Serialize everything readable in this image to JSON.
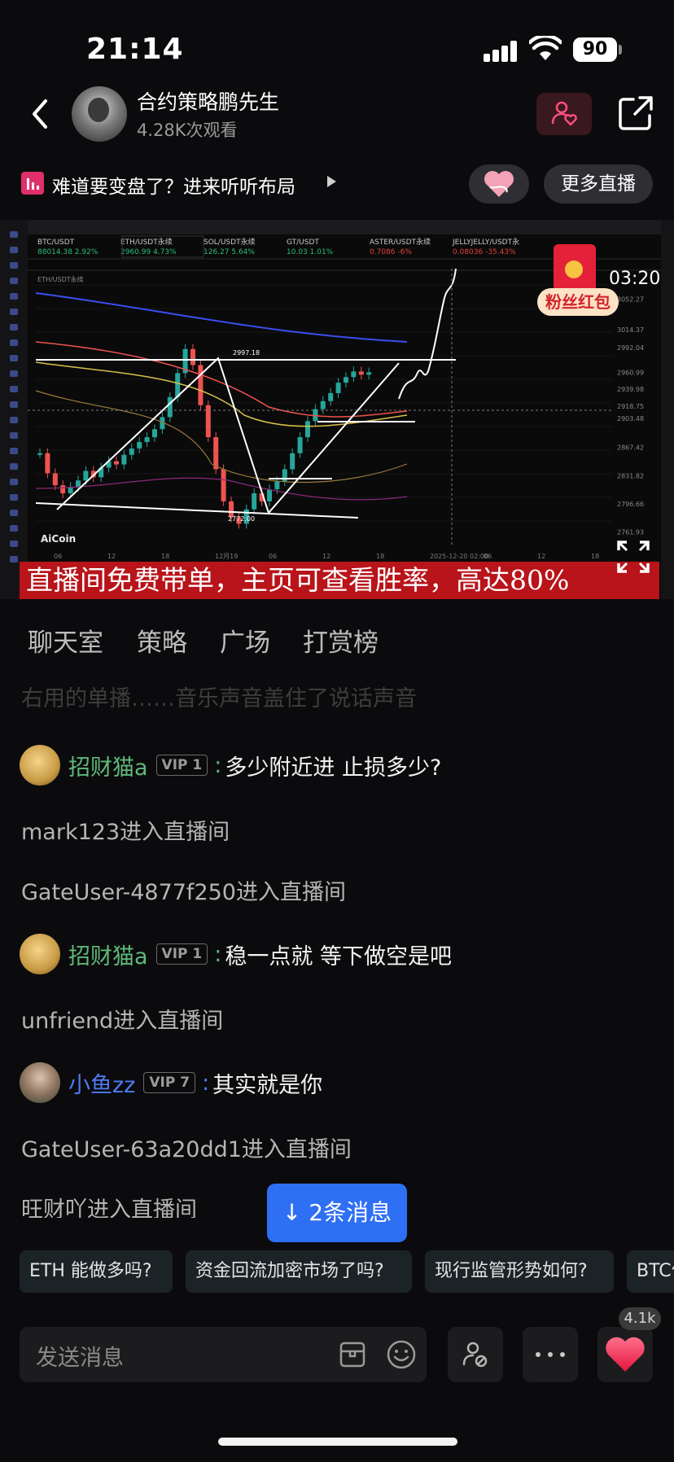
{
  "status_bar": {
    "time": "21:14",
    "battery": "90"
  },
  "header": {
    "streamer_name": "合约策略鹏先生",
    "view_count": "4.28K次观看"
  },
  "notice": {
    "text": "难道要变盘了？进来听听布局",
    "more_live_label": "更多直播"
  },
  "video": {
    "red_packet_label": "粉丝红包",
    "countdown": "03:20",
    "banner_text": "直播间免费带单，主页可查看胜率，高达80%",
    "chart_tickers": [
      {
        "name": "BTC/USDT",
        "price": "88014.38",
        "change": "2.92%",
        "color": "#2bbd7e"
      },
      {
        "name": "ETH/USDT永续",
        "price": "2960.99",
        "change": "4.73%",
        "color": "#2bbd7e"
      },
      {
        "name": "SOL/USDT永续",
        "price": "126.27",
        "change": "5.64%",
        "color": "#2bbd7e"
      },
      {
        "name": "GT/USDT",
        "price": "10.03",
        "change": "1.01%",
        "color": "#2bbd7e"
      },
      {
        "name": "ASTER/USDT永续",
        "price": "0.7086",
        "change": "-6%",
        "color": "#e5413a"
      },
      {
        "name": "JELLYJELLY/USDT永",
        "price": "0.08036",
        "change": "-35.43%",
        "color": "#e5413a"
      }
    ],
    "chart_pair": "ETH/USDT永续",
    "chart_price_labels": [
      "3052.27",
      "3014.37",
      "2992.04",
      "2960.99",
      "2939.98",
      "2918.75",
      "2903.48",
      "2867.42",
      "2831.82",
      "2796.66",
      "2761.93"
    ],
    "chart_annotation_high": "2997.18",
    "chart_annotation_low": "2772.00",
    "chart_brand": "AiCoin",
    "chart_time_labels": [
      "06",
      "12",
      "18",
      "12月19",
      "06",
      "12",
      "18",
      "2025-12-20 02:00",
      "06",
      "12",
      "18"
    ],
    "chart_colors": {
      "up": "#26a69a",
      "down": "#ef5350",
      "ema200": "#3b4ef0",
      "boll": "#d4c04a"
    }
  },
  "tabs": [
    {
      "label": "聊天室",
      "active": true
    },
    {
      "label": "策略",
      "active": false
    },
    {
      "label": "广场",
      "active": false
    },
    {
      "label": "打赏榜",
      "active": false
    }
  ],
  "chat": {
    "faded_line": "右用的单播……音乐声音盖住了说话声音",
    "items": [
      {
        "type": "message",
        "user": "招财猫a",
        "vip": "VIP 1",
        "text": "多少附近进  止损多少?",
        "name_color": "#5fb97a",
        "colon_color": "#5fb97a"
      },
      {
        "type": "enter",
        "text": "mark123进入直播间"
      },
      {
        "type": "enter",
        "text": "GateUser-4877f250进入直播间"
      },
      {
        "type": "message",
        "user": "招财猫a",
        "vip": "VIP 1",
        "text": "稳一点就 等下做空是吧",
        "name_color": "#5fb97a",
        "colon_color": "#5fb97a"
      },
      {
        "type": "enter",
        "text": "unfriend进入直播间"
      },
      {
        "type": "message",
        "user": "小鱼zz",
        "vip": "VIP 7",
        "text": "其实就是你",
        "name_color": "#4f7bf2",
        "colon_color": "#4f7bf2"
      },
      {
        "type": "enter",
        "text": "GateUser-63a20dd1进入直播间"
      },
      {
        "type": "enter",
        "text": "旺财吖进入直播间"
      }
    ],
    "new_messages_label": "↓ 2条消息"
  },
  "chips": [
    "ETH 能做多吗?",
    "资金回流加密市场了吗?",
    "现行监管形势如何?",
    "BTC价格走势如何?"
  ],
  "input": {
    "placeholder": "发送消息",
    "like_count": "4.1k"
  }
}
